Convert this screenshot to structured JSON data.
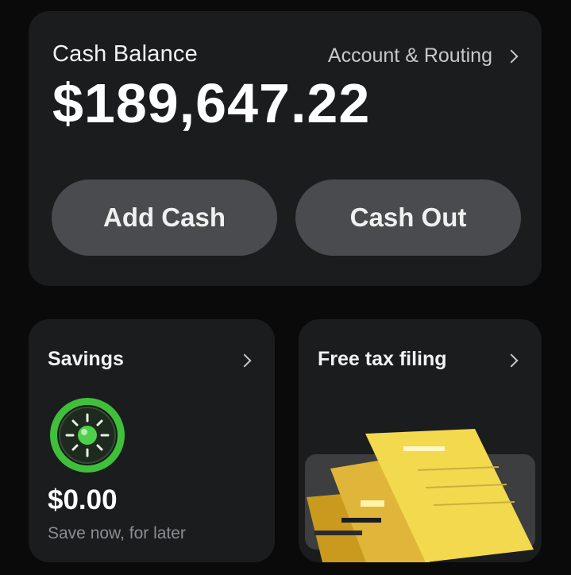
{
  "balance": {
    "title": "Cash Balance",
    "routing_link": "Account & Routing",
    "amount": "$189,647.22",
    "add_cash_label": "Add Cash",
    "cash_out_label": "Cash Out"
  },
  "savings": {
    "title": "Savings",
    "amount": "$0.00",
    "caption": "Save now, for later",
    "icon": "sun-coin-icon"
  },
  "tax": {
    "title": "Free tax filing",
    "icon": "tax-documents-icon"
  },
  "colors": {
    "background": "#0a0a0b",
    "card": "#1b1c1e",
    "pill": "#4a4b4e",
    "savings_green": "#3fbf3a",
    "tax_yellow": "#f2d94e"
  }
}
